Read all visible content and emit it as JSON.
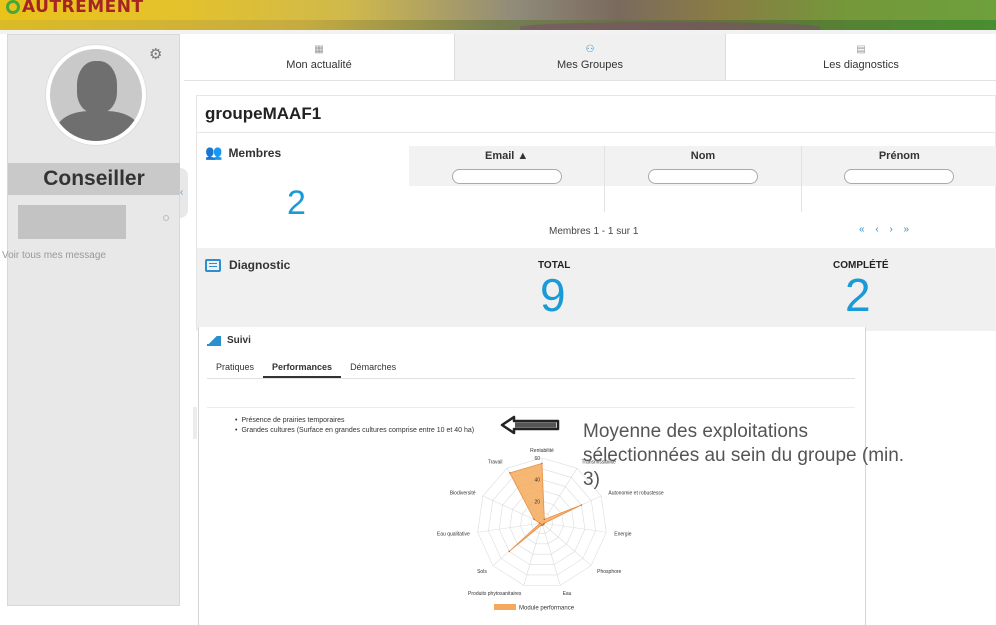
{
  "brand": {
    "logo_text": "AUTREMENT"
  },
  "sidebar": {
    "role": "Conseiller",
    "messages_link": "Voir tous mes message",
    "collapse_icon": "‹"
  },
  "nav": {
    "tabs": [
      {
        "label": "Mon actualité",
        "icon": "calendar-icon",
        "active": false
      },
      {
        "label": "Mes Groupes",
        "icon": "group-icon",
        "active": true
      },
      {
        "label": "Les diagnostics",
        "icon": "document-icon",
        "active": false
      }
    ]
  },
  "group": {
    "title": "groupeMAAF1",
    "members": {
      "label": "Membres",
      "count": "2",
      "columns": [
        {
          "header": "Email ▲"
        },
        {
          "header": "Nom"
        },
        {
          "header": "Prénom"
        }
      ],
      "range_text": "Membres 1 - 1 sur 1",
      "pager": "« ‹ › »"
    },
    "diagnostic": {
      "label": "Diagnostic",
      "total_label": "TOTAL",
      "total_value": "9",
      "complete_label": "COMPLÉTÉ",
      "complete_value": "2"
    }
  },
  "suivi": {
    "title": "Suivi",
    "tabs": [
      {
        "label": "Pratiques",
        "active": false
      },
      {
        "label": "Performances",
        "active": true
      },
      {
        "label": "Démarches",
        "active": false
      }
    ],
    "criteria": [
      "Présence de prairies temporaires",
      "Grandes cultures (Surface en grandes cultures comprise entre 10 et 40 ha)"
    ]
  },
  "chart_data": {
    "type": "radar",
    "axes": [
      "Rentabilité",
      "Transmissibilité",
      "Autonomie et robustesse",
      "Energie",
      "Phosphore",
      "Eau",
      "Produits phytosanitaires",
      "Sols",
      "Eau qualitative",
      "Biodiversité",
      "Travail"
    ],
    "r_ticks": [
      20,
      40,
      60
    ],
    "rmax": 60,
    "series": [
      {
        "name": "Module performance",
        "color": "#f4a95c",
        "values": [
          55,
          4,
          40,
          2,
          2,
          2,
          2,
          40,
          2,
          8,
          55
        ]
      }
    ]
  },
  "annotation": {
    "text": "Moyenne des exploitations\nsélectionnées au sein du groupe (min.\n3)"
  }
}
